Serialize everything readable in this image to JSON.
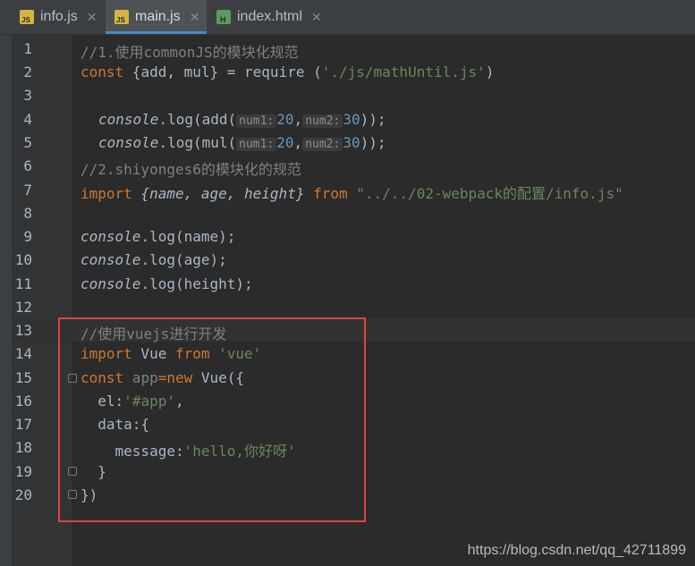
{
  "tabs": [
    {
      "label": "info.js",
      "icon": "js-file-icon",
      "type": "js"
    },
    {
      "label": "main.js",
      "icon": "js-file-icon",
      "type": "js",
      "active": true
    },
    {
      "label": "index.html",
      "icon": "html-file-icon",
      "type": "html"
    }
  ],
  "line_numbers": [
    "1",
    "2",
    "3",
    "4",
    "5",
    "6",
    "7",
    "8",
    "9",
    "10",
    "11",
    "12",
    "13",
    "14",
    "15",
    "16",
    "17",
    "18",
    "19",
    "20"
  ],
  "code": {
    "l1_comment": "//1.使用commonJS的模块化规范",
    "l2_const": "const",
    "l2_rest": " {add, mul} = ",
    "l2_require": "require",
    "l2_paren": " (",
    "l2_str": "'./js/mathUntil.js'",
    "l2_close": ")",
    "l4_console": "console",
    "l4_log": ".log(add(",
    "l4_hint1": "num1:",
    "l4_n1": "20",
    "l4_comma": ",",
    "l4_hint2": "num2:",
    "l4_n2": "30",
    "l4_end": "));",
    "l5_log": ".log(mul(",
    "l6_comment": "//2.shiyonges6的模块化的规范",
    "l7_import": "import",
    "l7_vars": " {name, age, height} ",
    "l7_from": "from",
    "l7_str": " \"../../02-webpack的配置/info.js\"",
    "l9": ".log(name);",
    "l10": ".log(age);",
    "l11": ".log(height);",
    "l13_comment": "//使用vuejs进行开发",
    "l14_import": "import",
    "l14_vue": " Vue ",
    "l14_from": "from",
    "l14_str": " 'vue'",
    "l15_const": "const",
    "l15_app": " app",
    "l15_eq": "=",
    "l15_new": "new",
    "l15_rest": " Vue({",
    "l16_el": "  el:",
    "l16_str": "'#app'",
    "l16_comma": ",",
    "l17_data": "  data:{",
    "l18_msg": "    message:",
    "l18_str": "'hello,你好呀'",
    "l19": "  }",
    "l20": "})"
  },
  "watermark": "https://blog.csdn.net/qq_42711899"
}
